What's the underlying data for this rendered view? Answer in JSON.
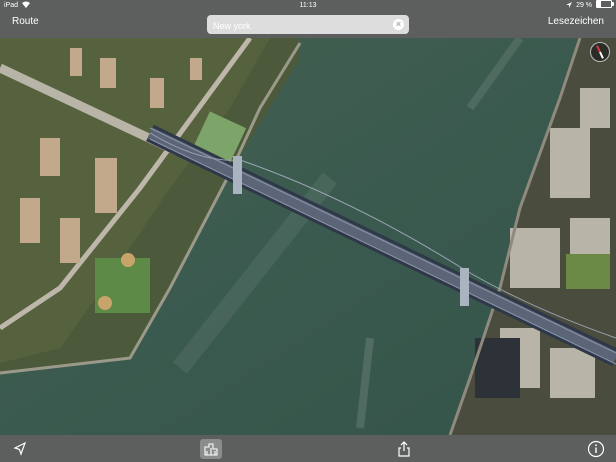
{
  "status": {
    "device": "iPad",
    "time": "11:13",
    "battery": "29 %"
  },
  "nav": {
    "route_label": "Route",
    "bookmarks_label": "Lesezeichen"
  },
  "search": {
    "value": "New york",
    "placeholder": "",
    "clear_icon": "clear-icon"
  },
  "map": {
    "mode": "satellite-3d",
    "compass_icon": "compass-icon"
  },
  "toolbar": {
    "location_icon": "location-arrow-icon",
    "buildings_icon": "3d-buildings-icon",
    "share_icon": "share-icon",
    "info_icon": "info-icon"
  },
  "colors": {
    "bar": "#5f5f5f",
    "water": "#3f5a4e",
    "bridge": "#5b6577"
  }
}
